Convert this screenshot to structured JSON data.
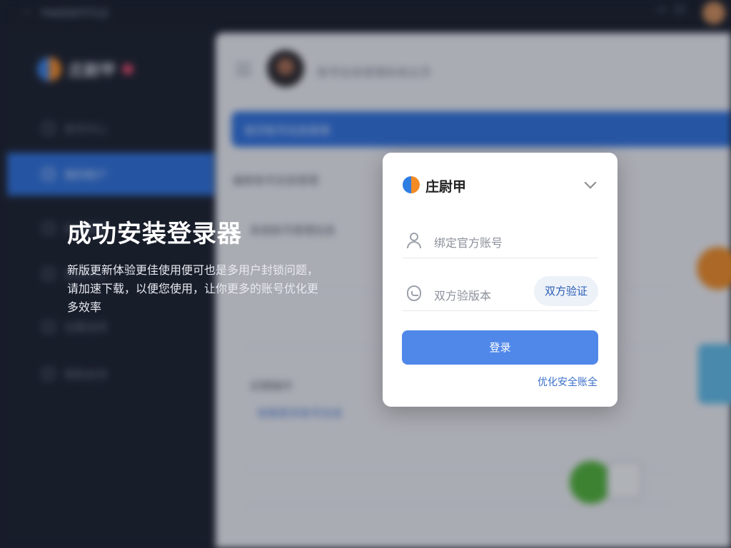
{
  "topbar": {
    "title": "FAKENTITLE"
  },
  "sidebar": {
    "brand": "庄尉甲",
    "items": [
      {
        "label": "首页中心"
      },
      {
        "label": "我的账户"
      },
      {
        "label": "账号管理"
      },
      {
        "label": "安全中心"
      },
      {
        "label": "设置选项"
      },
      {
        "label": "帮助支持"
      }
    ]
  },
  "main": {
    "header_text": "账号信息管理系统主页",
    "banner": "首页账号信息管理",
    "section1": "最新账号信息管理",
    "section2": "系统账号管理信息",
    "section3": "近期操作",
    "link_text": "查看更多账号信息"
  },
  "promo": {
    "title": "成功安装登录器",
    "desc": "新版更新体验更佳使用便可也是多用户封锁问题，请加速下载，以便您使用，让你更多的账号优化更多效率"
  },
  "login": {
    "brand": "庄尉甲",
    "account_placeholder": "绑定官方账号",
    "code_placeholder": "双方验版本",
    "twofa_label": "双方验证",
    "login_label": "登录",
    "security_link": "优化安全账全"
  },
  "colors": {
    "primary": "#5088ea",
    "sidebar_active": "#2f6fd6",
    "link": "#3a6fc9"
  }
}
